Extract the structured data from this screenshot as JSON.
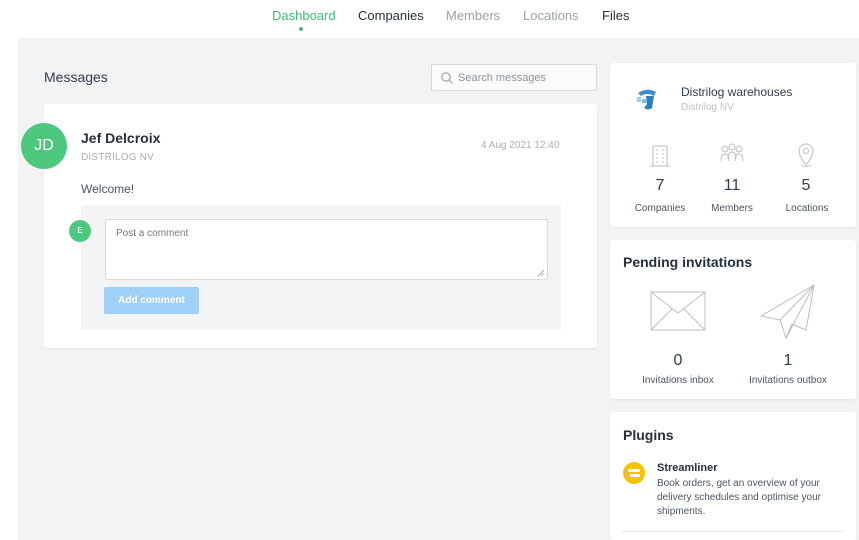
{
  "nav": {
    "items": [
      {
        "label": "Dashboard",
        "state": "active"
      },
      {
        "label": "Companies",
        "state": "bold"
      },
      {
        "label": "Members",
        "state": "muted"
      },
      {
        "label": "Locations",
        "state": "muted"
      },
      {
        "label": "Files",
        "state": "bold"
      }
    ],
    "accent_color": "#3cbf7a"
  },
  "messages": {
    "title": "Messages",
    "search_placeholder": "Search messages",
    "items": [
      {
        "author_initials": "JD",
        "author": "Jef Delcroix",
        "company": "DISTRILOG NV",
        "date": "4 Aug 2021 12:40",
        "text": "Welcome!"
      }
    ],
    "comment": {
      "user_initial": "E",
      "placeholder": "Post a comment",
      "button_label": "Add comment"
    }
  },
  "organization": {
    "name": "Distrilog warehouses",
    "subtitle": "Distrilog NV",
    "stats": [
      {
        "icon": "building-icon",
        "value": "7",
        "label": "Companies"
      },
      {
        "icon": "members-icon",
        "value": "11",
        "label": "Members"
      },
      {
        "icon": "location-pin-icon",
        "value": "5",
        "label": "Locations"
      }
    ]
  },
  "invitations": {
    "title": "Pending invitations",
    "inbox": {
      "icon": "envelope-icon",
      "value": "0",
      "label": "Invitations inbox"
    },
    "outbox": {
      "icon": "paper-plane-icon",
      "value": "1",
      "label": "Invitations outbox"
    }
  },
  "plugins": {
    "title": "Plugins",
    "items": [
      {
        "icon": "streamliner-icon",
        "name": "Streamliner",
        "description": "Book orders, get an overview of your delivery schedules and optimise your shipments."
      }
    ],
    "icon_color": "#f5c400"
  }
}
